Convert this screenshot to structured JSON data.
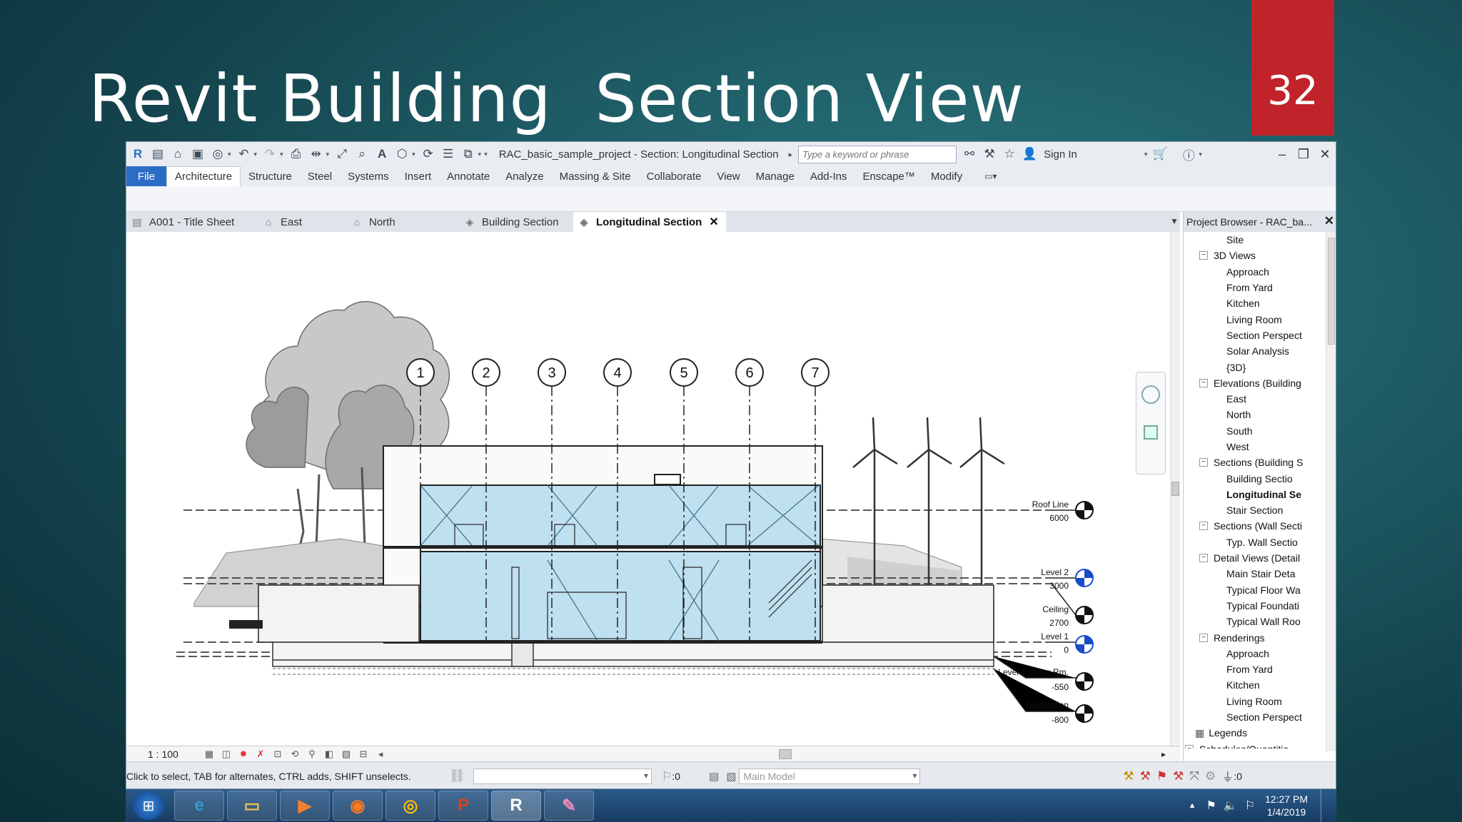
{
  "slide": {
    "title": "Revit Building  Section View",
    "number": "32"
  },
  "window": {
    "title": "RAC_basic_sample_project - Section: Longitudinal Section",
    "search_placeholder": "Type a keyword or phrase",
    "sign_in": "Sign In"
  },
  "ribbon_tabs": [
    "File",
    "Architecture",
    "Structure",
    "Steel",
    "Systems",
    "Insert",
    "Annotate",
    "Analyze",
    "Massing & Site",
    "Collaborate",
    "View",
    "Manage",
    "Add-Ins",
    "Enscape™",
    "Modify"
  ],
  "view_tabs": [
    {
      "label": "A001 - Title Sheet",
      "icon": "sheet-icon"
    },
    {
      "label": "East",
      "icon": "elevation-icon"
    },
    {
      "label": "North",
      "icon": "elevation-icon"
    },
    {
      "label": "Building Section",
      "icon": "section-icon"
    },
    {
      "label": "Longitudinal Section",
      "icon": "section-icon",
      "active": true
    }
  ],
  "grid_bubbles": [
    "1",
    "2",
    "3",
    "4",
    "5",
    "6",
    "7"
  ],
  "levels": [
    {
      "name": "Roof Line",
      "value": "6000"
    },
    {
      "name": "Level 2",
      "value": "3000"
    },
    {
      "name": "Ceiling",
      "value": "2700"
    },
    {
      "name": "Level 1",
      "value": "0"
    },
    {
      "name": "Level 1 Living Rm.",
      "value": "-550"
    },
    {
      "name": "Foundation",
      "value": "-800"
    }
  ],
  "project_browser": {
    "title": "Project Browser - RAC_ba...",
    "items": [
      {
        "label": "Site",
        "depth": 2
      },
      {
        "label": "3D Views",
        "depth": 1,
        "toggle": "−"
      },
      {
        "label": "Approach",
        "depth": 2
      },
      {
        "label": "From Yard",
        "depth": 2
      },
      {
        "label": "Kitchen",
        "depth": 2
      },
      {
        "label": "Living Room",
        "depth": 2
      },
      {
        "label": "Section Perspect",
        "depth": 2
      },
      {
        "label": "Solar Analysis",
        "depth": 2
      },
      {
        "label": "{3D}",
        "depth": 2
      },
      {
        "label": "Elevations (Building",
        "depth": 1,
        "toggle": "−"
      },
      {
        "label": "East",
        "depth": 2
      },
      {
        "label": "North",
        "depth": 2
      },
      {
        "label": "South",
        "depth": 2
      },
      {
        "label": "West",
        "depth": 2
      },
      {
        "label": "Sections (Building S",
        "depth": 1,
        "toggle": "−"
      },
      {
        "label": "Building Sectio",
        "depth": 2
      },
      {
        "label": "Longitudinal Se",
        "depth": 2,
        "bold": true
      },
      {
        "label": "Stair Section",
        "depth": 2
      },
      {
        "label": "Sections (Wall Secti",
        "depth": 1,
        "toggle": "−"
      },
      {
        "label": "Typ. Wall Sectio",
        "depth": 2
      },
      {
        "label": "Detail Views (Detail",
        "depth": 1,
        "toggle": "−"
      },
      {
        "label": "Main Stair Deta",
        "depth": 2
      },
      {
        "label": "Typical Floor Wa",
        "depth": 2
      },
      {
        "label": "Typical Foundati",
        "depth": 2
      },
      {
        "label": "Typical Wall Roo",
        "depth": 2
      },
      {
        "label": "Renderings",
        "depth": 1,
        "toggle": "−"
      },
      {
        "label": "Approach",
        "depth": 2
      },
      {
        "label": "From Yard",
        "depth": 2
      },
      {
        "label": "Kitchen",
        "depth": 2
      },
      {
        "label": "Living Room",
        "depth": 2
      },
      {
        "label": "Section Perspect",
        "depth": 2
      },
      {
        "label": "Legends",
        "depth": 0
      },
      {
        "label": "Schedules/Quantitie",
        "depth": 0,
        "toggle": "−"
      }
    ]
  },
  "view_control": {
    "scale": "1 : 100"
  },
  "status": {
    "message": "Click to select, TAB for alternates, CTRL adds, SHIFT unselects.",
    "count": ":0",
    "model": "Main Model",
    "filter": ":0"
  },
  "taskbar": {
    "apps": [
      "ie-icon",
      "folder-icon",
      "media-icon",
      "firefox-icon",
      "chrome-icon",
      "powerpoint-icon",
      "revit-icon",
      "paint-icon"
    ],
    "time": "12:27 PM",
    "date": "1/4/2019"
  }
}
